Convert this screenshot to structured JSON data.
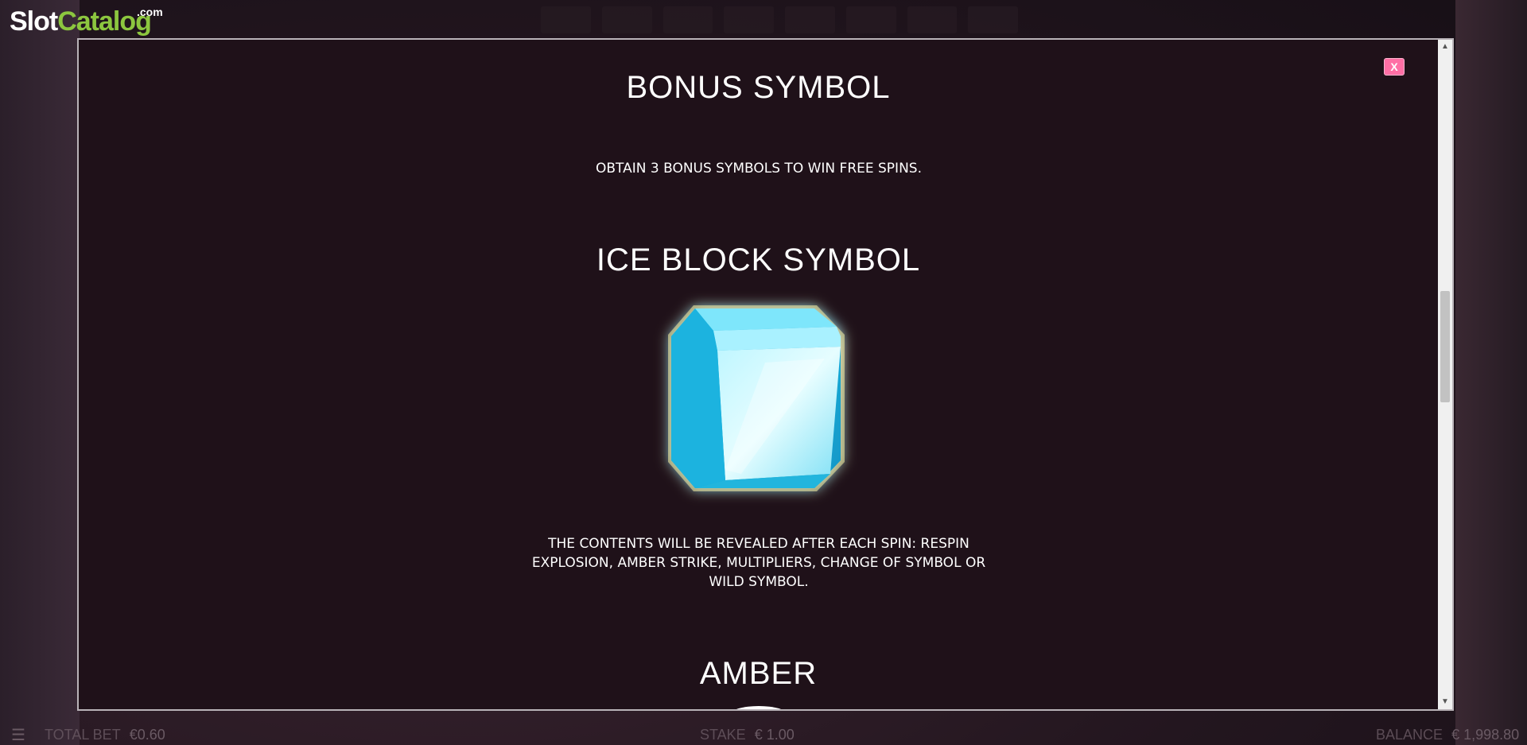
{
  "logo": {
    "slot": "Slot",
    "catalog": "Catalog",
    "com": ".com"
  },
  "modal": {
    "close_label": "X",
    "sections": {
      "bonus": {
        "title": "BONUS SYMBOL",
        "description": "OBTAIN 3 BONUS SYMBOLS TO WIN FREE SPINS."
      },
      "ice_block": {
        "title": "ICE BLOCK SYMBOL",
        "description": "THE CONTENTS WILL BE REVEALED AFTER EACH SPIN: RESPIN EXPLOSION, AMBER STRIKE, MULTIPLIERS, CHANGE OF SYMBOL OR WILD SYMBOL."
      },
      "amber": {
        "title": "AMBER"
      }
    }
  },
  "bottom_bar": {
    "bet_label": "TOTAL BET",
    "bet_value": "€0.60",
    "stake_label": "STAKE",
    "stake_value": "€ 1.00",
    "balance_label": "BALANCE",
    "balance_value": "€ 1,998.80"
  },
  "colors": {
    "close_button": "#ff6fa5",
    "modal_bg": "#1f1119",
    "logo_accent": "#8cc63f"
  },
  "icons": [
    "menu-icon",
    "ice-block-icon",
    "scroll-up-icon",
    "scroll-down-icon"
  ]
}
